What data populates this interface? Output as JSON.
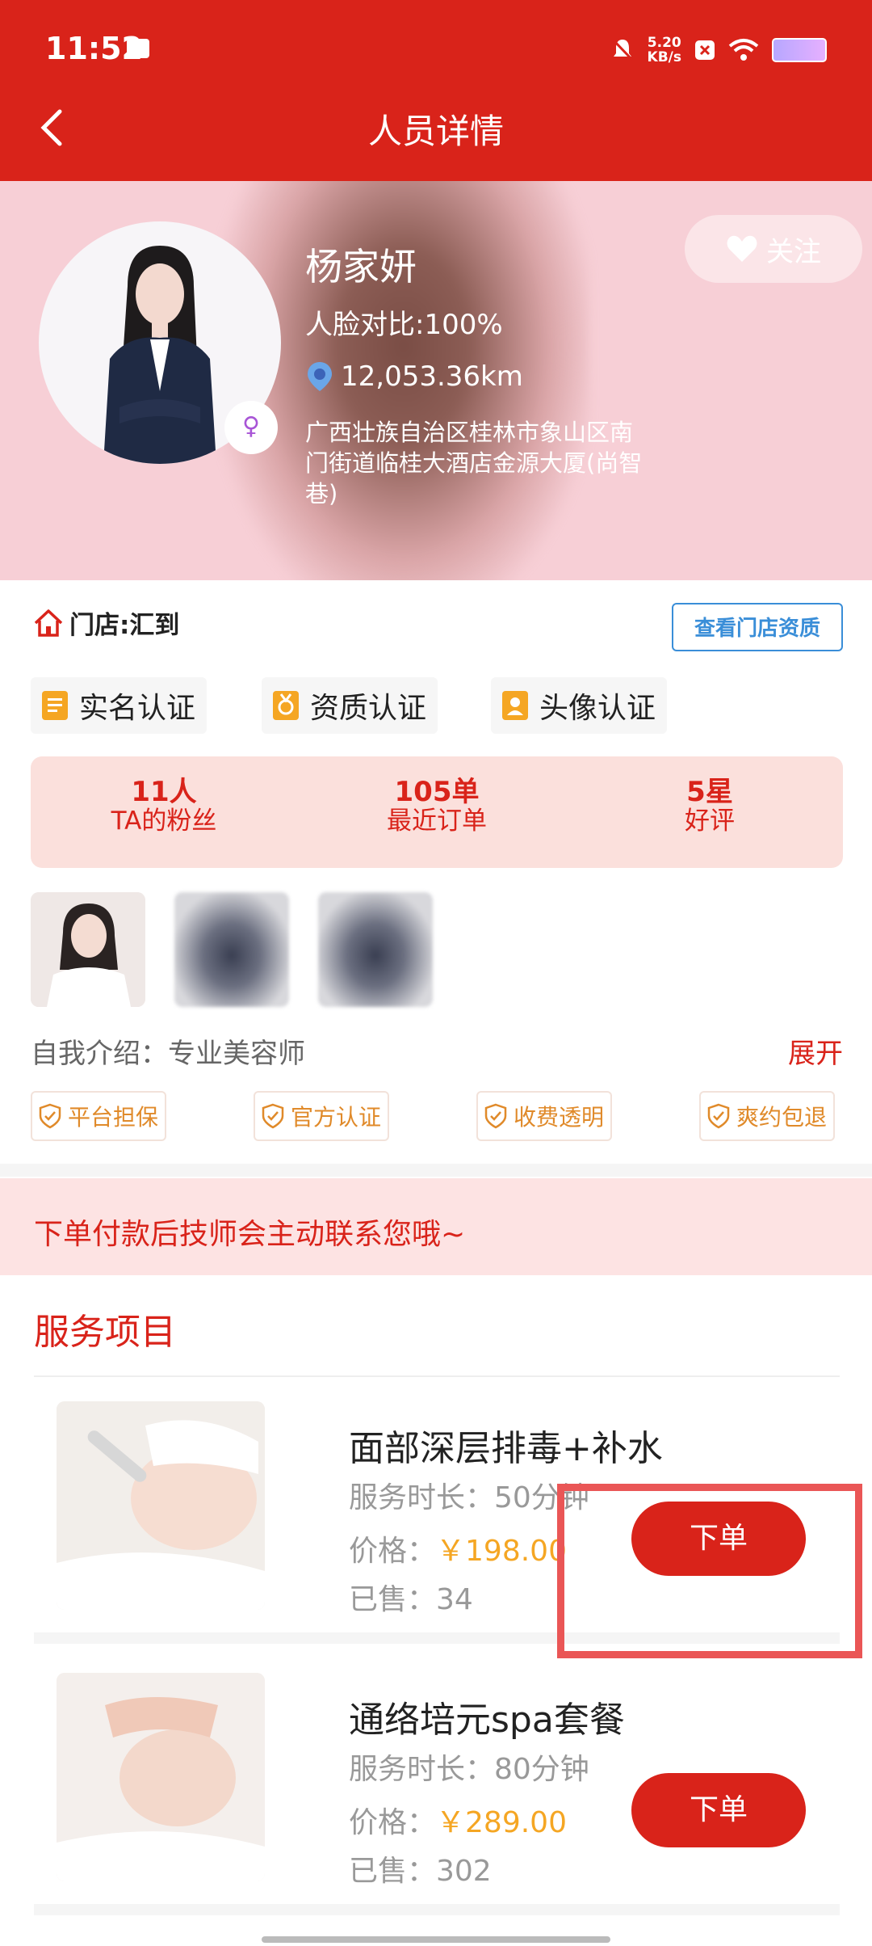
{
  "status_bar": {
    "time": "11:52",
    "speed_value": "5.20",
    "speed_unit": "KB/s"
  },
  "header": {
    "back_label": "<",
    "title": "人员详情"
  },
  "profile": {
    "name": "杨家妍",
    "face_match": "人脸对比:100%",
    "distance": "12,053.36km",
    "address": "广西壮族自治区桂林市象山区南门街道临桂大酒店金源大厦(尚智巷)",
    "follow_label": "关注"
  },
  "store": {
    "label": "门店:汇到",
    "qualification_button": "查看门店资质"
  },
  "certifications": [
    "实名认证",
    "资质认证",
    "头像认证"
  ],
  "stats": [
    {
      "value": "11人",
      "label": "TA的粉丝"
    },
    {
      "value": "105单",
      "label": "最近订单"
    },
    {
      "value": "5星",
      "label": "好评"
    }
  ],
  "intro": {
    "text": "自我介绍：专业美容师",
    "expand_label": "展开"
  },
  "guarantees": [
    "平台担保",
    "官方认证",
    "收费透明",
    "爽约包退"
  ],
  "notice": "下单付款后技师会主动联系您哦~",
  "services_title": "服务项目",
  "services": [
    {
      "name": "面部深层排毒+补水",
      "duration": "服务时长：50分钟",
      "price_label": "价格：",
      "price": "￥198.00",
      "sold": "已售：34",
      "order_label": "下单"
    },
    {
      "name": "通络培元spa套餐",
      "duration": "服务时长：80分钟",
      "price_label": "价格：",
      "price": "￥289.00",
      "sold": "已售：302",
      "order_label": "下单"
    }
  ],
  "colors": {
    "brand_red": "#d9231a",
    "price_orange": "#f5a623",
    "link_blue": "#3a8ed8",
    "highlight_red": "#ea5656"
  }
}
